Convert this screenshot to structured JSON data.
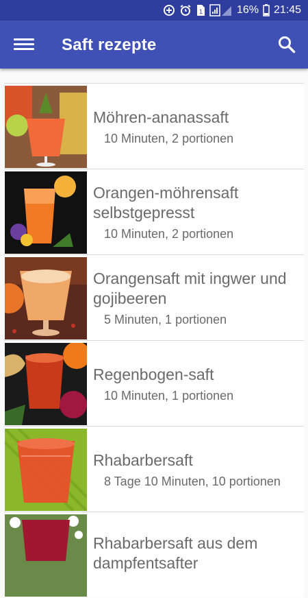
{
  "status_bar": {
    "battery_percent": "16%",
    "time": "21:45",
    "colors": {
      "background": "#2f3e9e"
    }
  },
  "app_bar": {
    "title": "Saft rezepte",
    "color": "#3f51b5"
  },
  "recipes": [
    {
      "title_lines": [
        "Möhren-ananassaft"
      ],
      "meta": "10 Minuten, 2 portionen"
    },
    {
      "title_lines": [
        "Orangen-möhrensaft",
        "selbstgepresst"
      ],
      "meta": "10 Minuten, 2 portionen"
    },
    {
      "title_lines": [
        "Orangensaft mit ingwer und",
        "gojibeeren"
      ],
      "meta": "5 Minuten, 1 portionen"
    },
    {
      "title_lines": [
        "Regenbogen-saft"
      ],
      "meta": "10 Minuten, 1 portionen"
    },
    {
      "title_lines": [
        "Rhabarbersaft"
      ],
      "meta": "8 Tage 10 Minuten, 10 portionen"
    },
    {
      "title_lines": [
        "Rhabarbersaft aus dem",
        "dampfentsafter"
      ],
      "meta": ""
    }
  ]
}
